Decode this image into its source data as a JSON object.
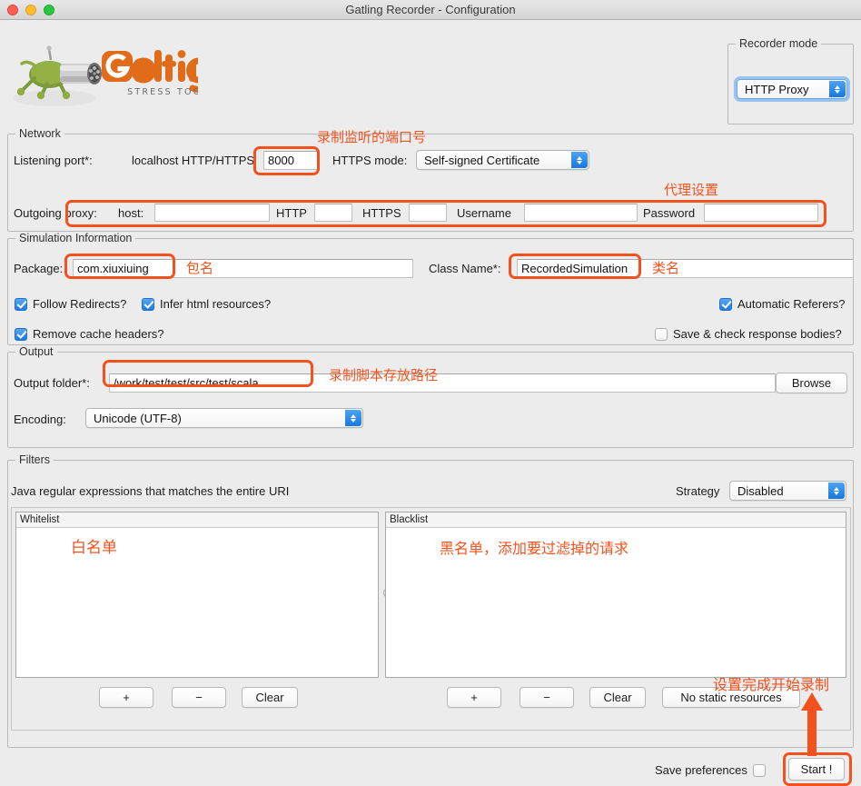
{
  "window": {
    "title": "Gatling Recorder - Configuration",
    "traffic_lights": [
      "close",
      "minimize",
      "zoom"
    ]
  },
  "logo": {
    "wordmark": "Gatling",
    "tagline": "STRESS TOOL",
    "brand_color": "#e06c19"
  },
  "recorder_mode": {
    "group_title": "Recorder mode",
    "selected": "HTTP Proxy"
  },
  "network": {
    "group_title": "Network",
    "listening_port_label": "Listening port*:",
    "localhost_label": "localhost HTTP/HTTPS",
    "port_value": "8000",
    "https_mode_label": "HTTPS mode:",
    "https_mode_value": "Self-signed Certificate",
    "outgoing_label": "Outgoing proxy:",
    "host_label": "host:",
    "host_value": "",
    "http_label": "HTTP",
    "http_value": "",
    "https_label": "HTTPS",
    "https_value": "",
    "username_label": "Username",
    "username_value": "",
    "password_label": "Password",
    "password_value": ""
  },
  "simulation": {
    "group_title": "Simulation Information",
    "package_label": "Package:",
    "package_value": "com.xiuxiuing",
    "class_name_label": "Class Name*:",
    "class_name_value": "RecordedSimulation",
    "checkboxes": [
      {
        "label": "Follow Redirects?",
        "checked": true
      },
      {
        "label": "Infer html resources?",
        "checked": true
      },
      {
        "label": "Automatic Referers?",
        "checked": true
      },
      {
        "label": "Remove cache headers?",
        "checked": true
      },
      {
        "label": "Save & check response bodies?",
        "checked": false
      }
    ]
  },
  "output": {
    "group_title": "Output",
    "folder_label": "Output folder*:",
    "folder_value": "/work/test/test/src/test/scala",
    "browse_label": "Browse",
    "encoding_label": "Encoding:",
    "encoding_value": "Unicode (UTF-8)"
  },
  "filters": {
    "group_title": "Filters",
    "hint": "Java regular expressions that matches the entire URI",
    "strategy_label": "Strategy",
    "strategy_value": "Disabled",
    "whitelist": {
      "header": "Whitelist",
      "items": [],
      "buttons": [
        "+",
        "−",
        "Clear"
      ]
    },
    "blacklist": {
      "header": "Blacklist",
      "items": [],
      "buttons": [
        "+",
        "−",
        "Clear",
        "No static resources"
      ]
    }
  },
  "footer": {
    "save_preferences_label": "Save preferences",
    "save_preferences_checked": false,
    "start_label": "Start !"
  },
  "annotations": {
    "color": "#f4511e",
    "port": "录制监听的端口号",
    "proxy": "代理设置",
    "package": "包名",
    "class_name": "类名",
    "output_folder": "录制脚本存放路径",
    "whitelist": "白名单",
    "blacklist": "黑名单，添加要过滤掉的请求",
    "start": "设置完成开始录制"
  }
}
